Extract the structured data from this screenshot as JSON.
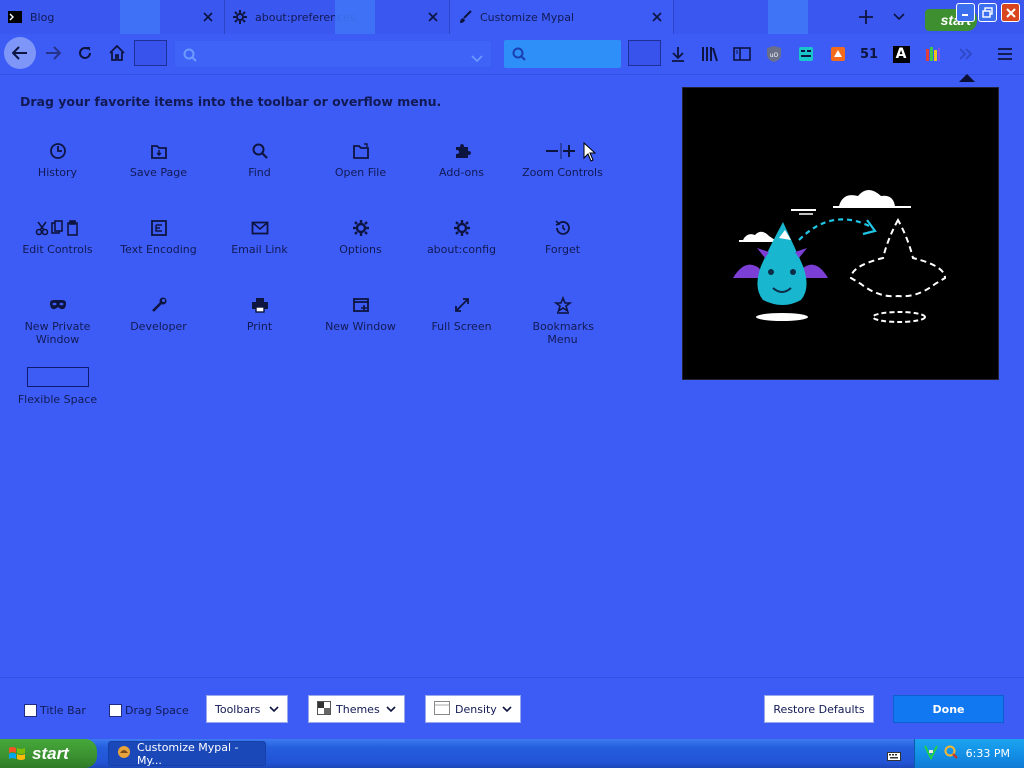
{
  "tabs": [
    {
      "title": "Blog",
      "icon": "terminal-icon",
      "selected": false
    },
    {
      "title": "about:preferences",
      "icon": "gear-icon",
      "selected": false
    },
    {
      "title": "Customize Mypal",
      "icon": "paintbrush-icon",
      "selected": true
    }
  ],
  "toolbar": {
    "counter": "51",
    "letter_icon": "A"
  },
  "customize": {
    "heading": "Drag your favorite items into the toolbar or overflow menu.",
    "items": [
      {
        "label": "History",
        "icon": "clock-icon"
      },
      {
        "label": "Save Page",
        "icon": "save-page-icon"
      },
      {
        "label": "Find",
        "icon": "magnifier-icon"
      },
      {
        "label": "Open File",
        "icon": "folder-icon"
      },
      {
        "label": "Add-ons",
        "icon": "puzzle-icon"
      },
      {
        "label": "Zoom Controls",
        "icon": "zoom-icon"
      },
      {
        "label": "Edit Controls",
        "icon": "edit-icon"
      },
      {
        "label": "Text Encoding",
        "icon": "encoding-icon"
      },
      {
        "label": "Email Link",
        "icon": "envelope-icon"
      },
      {
        "label": "Options",
        "icon": "gear-icon"
      },
      {
        "label": "about:config",
        "icon": "gear-icon"
      },
      {
        "label": "Forget",
        "icon": "forget-icon"
      },
      {
        "label": "New Private Window",
        "icon": "mask-icon"
      },
      {
        "label": "Developer",
        "icon": "wrench-icon"
      },
      {
        "label": "Print",
        "icon": "printer-icon"
      },
      {
        "label": "New Window",
        "icon": "new-window-icon"
      },
      {
        "label": "Full Screen",
        "icon": "fullscreen-icon"
      },
      {
        "label": "Bookmarks Menu",
        "icon": "bookmarks-menu-icon"
      },
      {
        "label": "Flexible Space",
        "icon": "flexible-space-box"
      }
    ]
  },
  "footer": {
    "title_bar": "Title Bar",
    "drag_space": "Drag Space",
    "toolbars": "Toolbars",
    "themes": "Themes",
    "density": "Density",
    "restore": "Restore Defaults",
    "done": "Done"
  },
  "taskbar": {
    "start": "start",
    "task_title": "Customize Mypal - My...",
    "clock": "6:33 PM"
  },
  "colors": {
    "background": "#3d5cf5",
    "done_button": "#1278f2",
    "text": "#121a55"
  }
}
